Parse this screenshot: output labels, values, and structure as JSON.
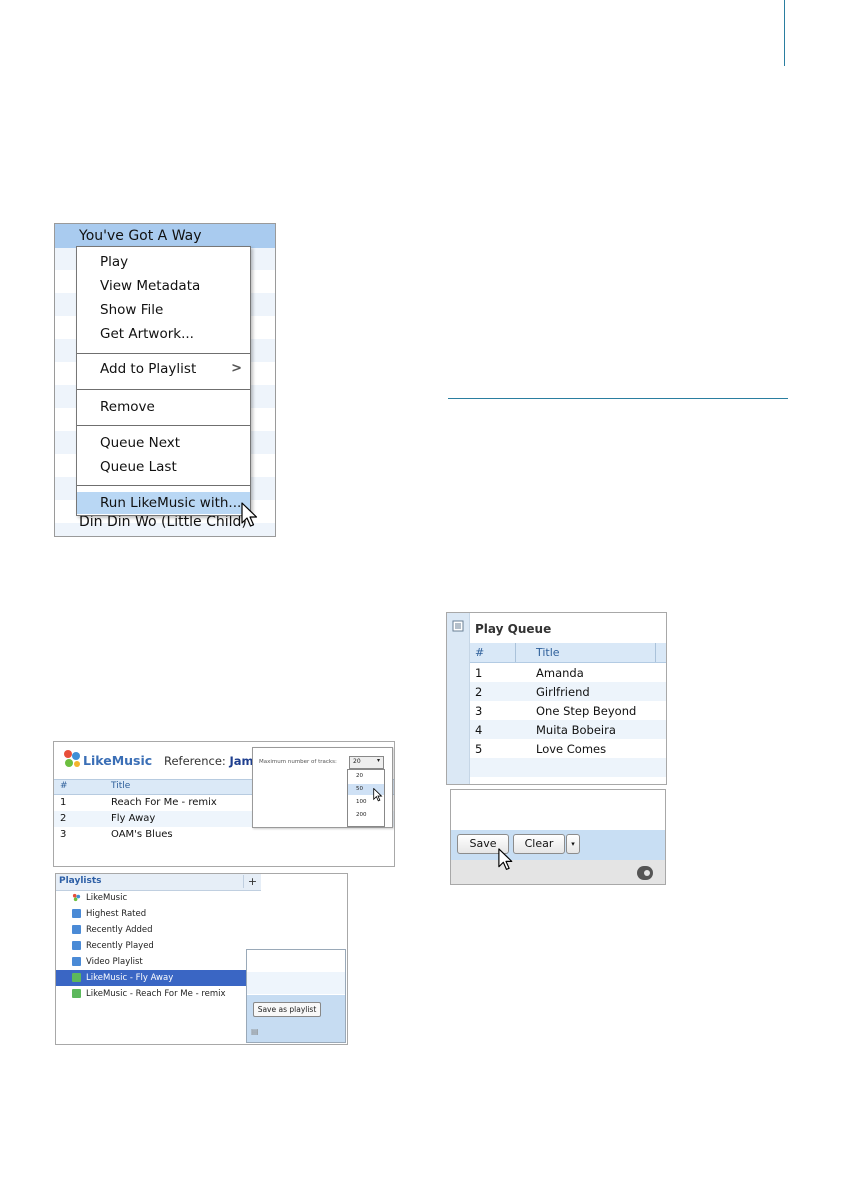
{
  "context_menu_shot": {
    "selected_row": "You've Got A Way",
    "bottom_row": "Din Din Wo (Little Child)",
    "menu_items": [
      {
        "label": "Play"
      },
      {
        "label": "View Metadata"
      },
      {
        "label": "Show File"
      },
      {
        "label": "Get Artwork..."
      },
      {
        "label": "Add to Playlist",
        "submenu": true
      },
      {
        "label": "Remove"
      },
      {
        "label": "Queue Next"
      },
      {
        "label": "Queue Last"
      },
      {
        "label": "Run LikeMusic with...",
        "highlighted": true
      }
    ],
    "submenu_arrow": ">"
  },
  "likemusic_shot": {
    "app_name": "LikeMusic",
    "reference_label": "Reference:",
    "reference_value": "Jamie",
    "columns": [
      "#",
      "Title"
    ],
    "rows": [
      {
        "num": "1",
        "title": "Reach For Me - remix"
      },
      {
        "num": "2",
        "title": "Fly Away"
      },
      {
        "num": "3",
        "title": "OAM's Blues"
      }
    ],
    "popup": {
      "label": "Maximum number of tracks:",
      "selected": "20",
      "options": [
        "20",
        "50",
        "100",
        "200"
      ],
      "hovered_option": "50"
    }
  },
  "playlists_shot": {
    "header": "Playlists",
    "add_button": "+",
    "items": [
      {
        "label": "LikeMusic",
        "icon": "likemusic-logo-icon"
      },
      {
        "label": "Highest Rated",
        "icon": "smart-playlist-icon"
      },
      {
        "label": "Recently Added",
        "icon": "smart-playlist-icon"
      },
      {
        "label": "Recently Played",
        "icon": "smart-playlist-icon"
      },
      {
        "label": "Video Playlist",
        "icon": "smart-playlist-icon"
      },
      {
        "label": "LikeMusic - Fly Away",
        "icon": "playlist-icon",
        "selected": true
      },
      {
        "label": "LikeMusic - Reach For Me - remix",
        "icon": "playlist-icon"
      }
    ],
    "save_button": "Save as playlist"
  },
  "play_queue_shot": {
    "title": "Play Queue",
    "columns": [
      "#",
      "Title"
    ],
    "rows": [
      {
        "num": "1",
        "title": "Amanda"
      },
      {
        "num": "2",
        "title": "Girlfriend"
      },
      {
        "num": "3",
        "title": "One Step Beyond"
      },
      {
        "num": "4",
        "title": "Muita Bobeira"
      },
      {
        "num": "5",
        "title": "Love Comes"
      }
    ]
  },
  "save_clear_shot": {
    "save_button": "Save",
    "clear_button": "Clear",
    "dropdown_arrow": "▾"
  },
  "colors": {
    "accent_line": "#2a7ea0",
    "selection_blue": "#a9cbef",
    "playlist_selection": "#3a66c4"
  }
}
